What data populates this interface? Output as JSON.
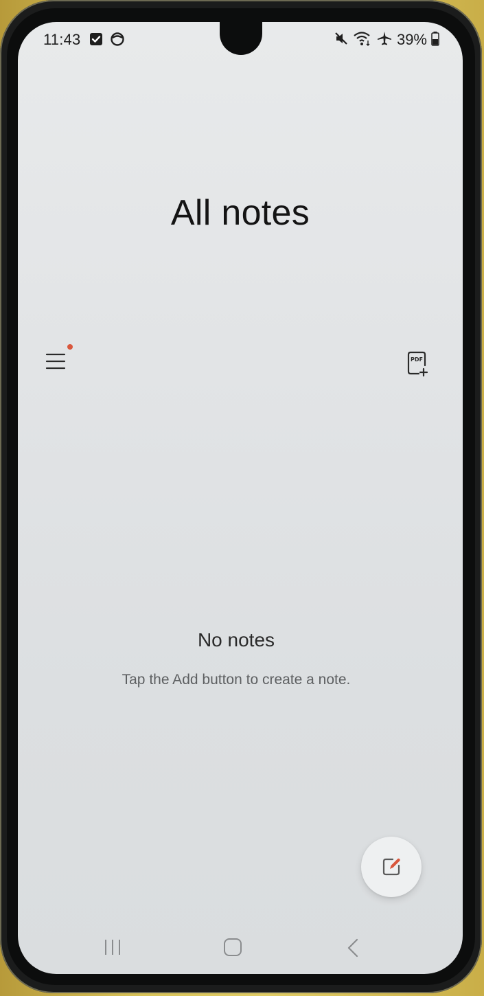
{
  "status_bar": {
    "time": "11:43",
    "battery_percent": "39%",
    "left_icons": [
      "checkbox-notification-icon",
      "sync-notification-icon"
    ],
    "right_icons": [
      "mute-icon",
      "wifi-icon",
      "airplane-icon",
      "battery-icon"
    ]
  },
  "header": {
    "title": "All notes"
  },
  "toolbar": {
    "menu_icon": "hamburger-menu-icon",
    "menu_badge": true,
    "pdf_icon": "pdf-add-icon",
    "badge_color": "#d9573d"
  },
  "empty_state": {
    "title": "No notes",
    "hint": "Tap the Add button to create a note."
  },
  "fab": {
    "icon": "compose-note-icon",
    "accent_color": "#d9573d"
  },
  "nav_bar": {
    "buttons": [
      "recents-button",
      "home-button",
      "back-button"
    ]
  }
}
